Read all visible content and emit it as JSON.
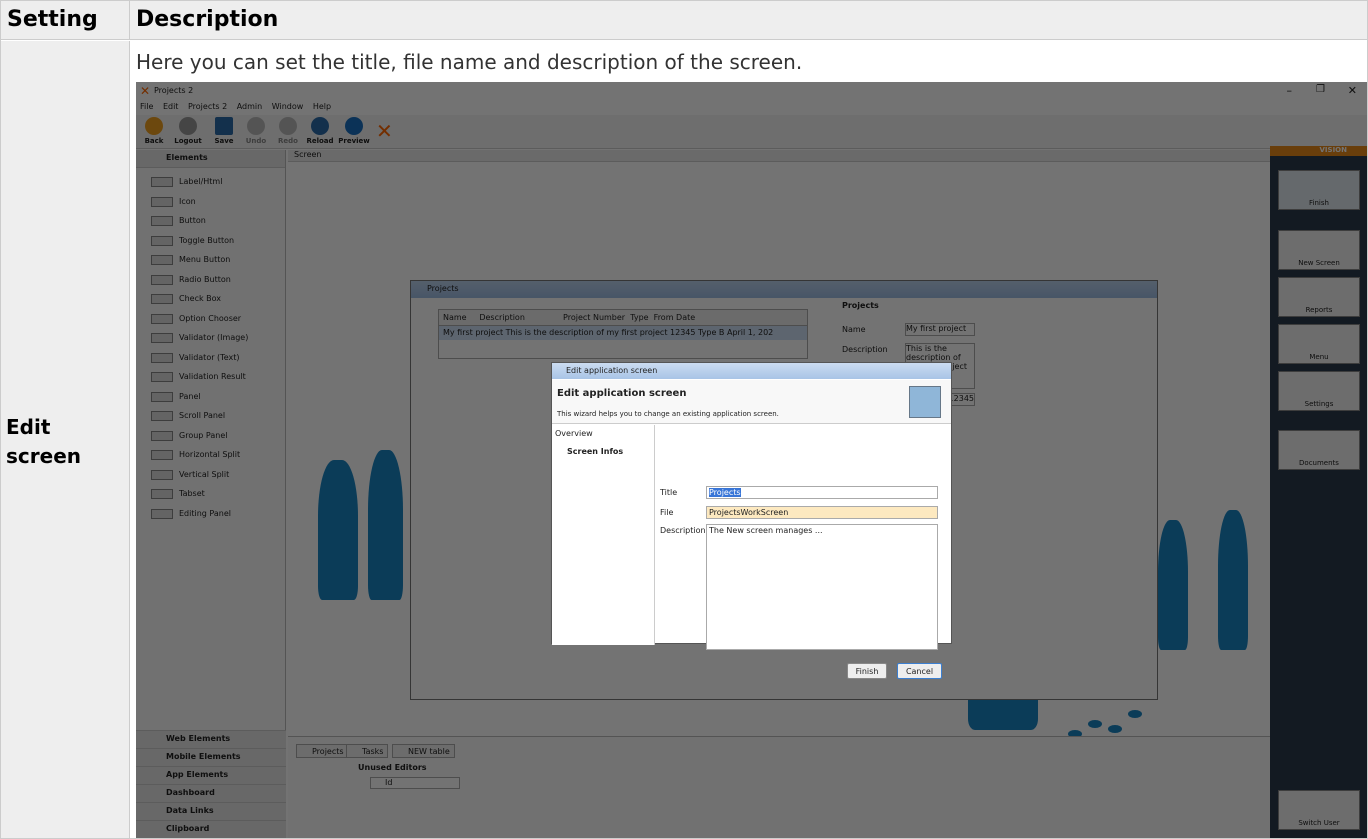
{
  "table": {
    "headers": [
      "Setting",
      "Description"
    ],
    "row": {
      "setting": "Edit screen",
      "description": "Here you can set the title, file name and description of the screen."
    }
  },
  "app": {
    "window_title": "Projects 2",
    "menu": [
      "File",
      "Edit",
      "Projects 2",
      "Admin",
      "Window",
      "Help"
    ],
    "toolbar": [
      "Back",
      "Logout",
      "Save",
      "Undo",
      "Redo",
      "Reload",
      "Preview"
    ],
    "elements_header": "Elements",
    "elements": [
      "Label/Html",
      "Icon",
      "Button",
      "Toggle Button",
      "Menu Button",
      "Radio Button",
      "Check Box",
      "Option Chooser",
      "Validator (Image)",
      "Validator (Text)",
      "Validation Result",
      "Panel",
      "Scroll Panel",
      "Group Panel",
      "Horizontal Split",
      "Vertical Split",
      "Tabset",
      "Editing Panel"
    ],
    "bottom_sections": [
      "Web Elements",
      "Mobile Elements",
      "App Elements",
      "Dashboard",
      "Data Links",
      "Clipboard"
    ],
    "breadcrumb": "Screen",
    "projects_window": {
      "title": "Projects",
      "columns": [
        "Name",
        "Description",
        "Project Number",
        "Type",
        "From Date"
      ],
      "row": [
        "My first project",
        "This is the description of my first project",
        "12345",
        "Type B",
        "April 1, 202"
      ],
      "form_title": "Projects",
      "form_labels": [
        "Name",
        "Description"
      ],
      "form_values": [
        "My first project",
        "This is the description of my first project",
        "12345"
      ]
    },
    "dialog": {
      "title": "Edit application screen",
      "heading": "Edit application screen",
      "subtitle": "This wizard helps you to change an existing application screen.",
      "overview": "Overview",
      "step": "Screen Infos",
      "labels": [
        "Title",
        "File",
        "Description"
      ],
      "values": [
        "Projects",
        "ProjectsWorkScreen",
        "The New screen manages ..."
      ],
      "finish": "Finish",
      "cancel": "Cancel"
    },
    "right_panel": {
      "brand": "VISION",
      "items": [
        "Finish",
        "New Screen",
        "Reports",
        "Menu",
        "Settings",
        "Documents"
      ],
      "switch_user": "Switch User"
    },
    "bottom_tabs": [
      "Projects",
      "Tasks",
      "NEW table"
    ],
    "unused_editors": "Unused Editors",
    "id_field": "Id"
  }
}
